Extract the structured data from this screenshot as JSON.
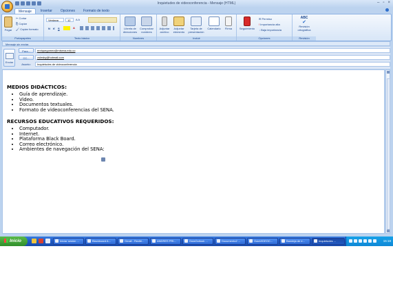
{
  "window": {
    "title": "Inquietudes de videoconferencia - Mensaje (HTML)",
    "controls": [
      "–",
      "▫",
      "×"
    ]
  },
  "ribbon": {
    "tabs": [
      "Mensaje",
      "Insertar",
      "Opciones",
      "Formato de texto"
    ],
    "active_tab": "Mensaje",
    "clipboard": {
      "paste": "Pegar",
      "cut": "Cortar",
      "copy": "Copiar",
      "format_painter": "Copiar formato",
      "label": "Portapapeles"
    },
    "basic_text": {
      "font": "Verdana",
      "size": "12",
      "bold": "N",
      "italic": "K",
      "underline": "S",
      "label": "Texto básico"
    },
    "names": {
      "address_book": "Libreta de direcciones",
      "check_names": "Comprobar nombres",
      "label": "Nombres"
    },
    "include": {
      "attach_file": "Adjuntar archivo",
      "attach_item": "Adjuntar elemento",
      "business_card": "Tarjeta de presentación",
      "calendar": "Calendario",
      "signature": "Firma",
      "label": "Incluir"
    },
    "options": {
      "follow_up": "Seguimiento",
      "permission": "Permiso",
      "high_importance": "Importancia alta",
      "low_importance": "Baja importancia",
      "label": "Opciones"
    },
    "proofing": {
      "spelling": "Revisión ortográfica",
      "spell_icon": "ABC",
      "label": "Revisión"
    }
  },
  "message": {
    "info_bar": "Mensaje sin enviar.",
    "send_label": "Enviar",
    "to_button": "Para...",
    "to_value": "enriquegomez@misena.edu.co",
    "cc_button": "CC...",
    "cc_value": "zulesky@hotmail.com",
    "subject_label": "Asunto:",
    "subject_value": "Inquietudes de videoconferencia"
  },
  "body": {
    "section1_title": "MEDIOS DIDÁCTICOS:",
    "section1_items": [
      "Guía de aprendizaje.",
      "Video.",
      "Documentos textuales.",
      "Formato de videoconferencias del SENA."
    ],
    "section2_title": "RECURSOS EDUCATIVOS REQUERIDOS:",
    "section2_items": [
      "Computador.",
      "Internet.",
      "Plataforma Black Board.",
      "Correo electrónico.",
      "Ambientes de navegación del SENA:"
    ]
  },
  "taskbar": {
    "start": "Inicio",
    "tasks": [
      "Iniciar sesión ...",
      "Blackboard A...",
      "Gmail - Recibi...",
      "ANDRES PRI...",
      "GuiaOutlook ...",
      "Documento2 ...",
      "GuiaVIDEOC...",
      "Bandeja de e...",
      "Inquietudes ..."
    ],
    "clock": "15:18"
  }
}
